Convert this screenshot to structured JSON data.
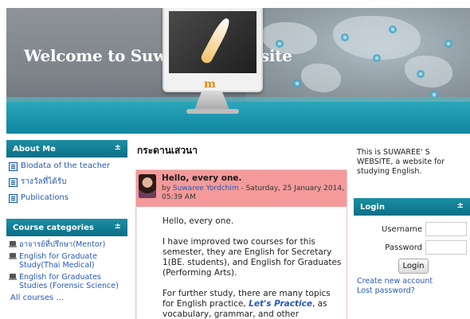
{
  "header": {
    "title": "Welcome to Suwaree's Website",
    "logo_text": "m"
  },
  "left": {
    "about": {
      "title": "About Me",
      "items": [
        {
          "label": "Biodata of the teacher"
        },
        {
          "label": "รางวัลที่ได้รับ"
        },
        {
          "label": "Publications"
        }
      ]
    },
    "categories": {
      "title": "Course categories",
      "items": [
        {
          "label": "อาจารย์ที่ปรึกษา(Mentor)"
        },
        {
          "label": "English for Graduate Study(Thai Medical)"
        },
        {
          "label": "English for Graduates Studies (Forensic Science)"
        }
      ],
      "all_courses": "All courses ..."
    },
    "collapse_glyph": "±"
  },
  "center": {
    "forum_title": "กระดานเสวนา",
    "post": {
      "subject": "Hello, every one.",
      "by_prefix": "by ",
      "author": "Suwaree Yordchim",
      "date": " - Saturday, 25 January 2014, 05:39 AM",
      "p1": "Hello, every one.",
      "p2": "I have improved two courses for this semester, they are English for Secretary 1(BE. students), and English for Graduates (Performing Arts).",
      "p3_before": "For further study, there are many topics for English practice, ",
      "p3_link": "Let's Practice",
      "p3_after": ", as vocabulary, grammar, and other expressions. You can join"
    }
  },
  "right": {
    "site_desc": "This is SUWAREE' S WEBSITE, a website for studying English.",
    "login": {
      "title": "Login",
      "username_label": "Username",
      "password_label": "Password",
      "button": "Login",
      "create_account": "Create new account",
      "lost_password": "Lost password?"
    }
  },
  "colors": {
    "block_header": "#0a6f86",
    "post_header": "#f49a9a",
    "link": "#2758b4"
  }
}
